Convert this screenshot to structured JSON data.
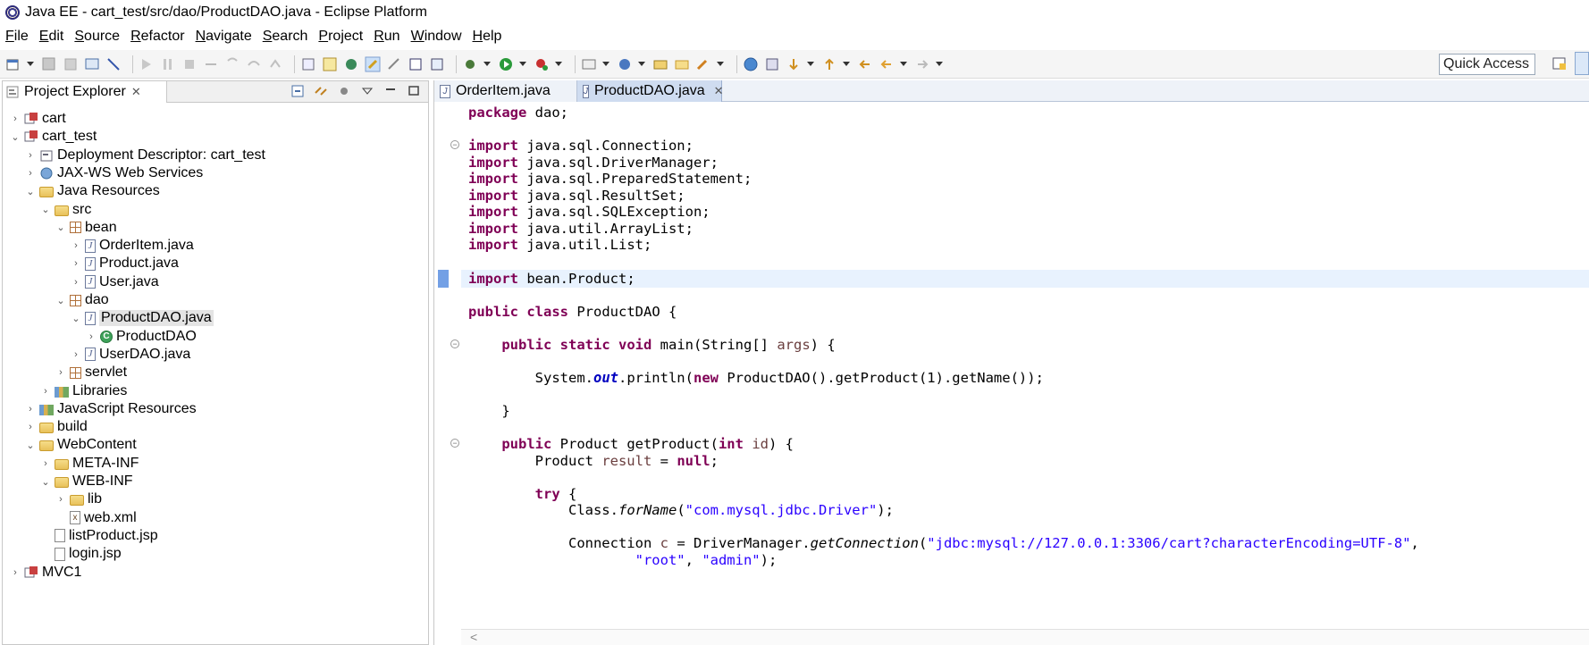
{
  "window": {
    "title": "Java EE - cart_test/src/dao/ProductDAO.java - Eclipse Platform"
  },
  "menu": [
    "File",
    "Edit",
    "Source",
    "Refactor",
    "Navigate",
    "Search",
    "Project",
    "Run",
    "Window",
    "Help"
  ],
  "toolbar": {
    "quick_access_label": "Quick Access"
  },
  "explorer": {
    "tab_label": "Project Explorer",
    "close": "✕",
    "items": [
      {
        "label": "cart",
        "depth": 0,
        "expanded": false,
        "icon": "project-icon"
      },
      {
        "label": "cart_test",
        "depth": 0,
        "expanded": true,
        "icon": "project-icon"
      },
      {
        "label": "Deployment Descriptor: cart_test",
        "depth": 1,
        "expanded": false,
        "icon": "deployment-descriptor-icon"
      },
      {
        "label": "JAX-WS Web Services",
        "depth": 1,
        "expanded": false,
        "icon": "web-services-icon"
      },
      {
        "label": "Java Resources",
        "depth": 1,
        "expanded": true,
        "icon": "java-resources-icon"
      },
      {
        "label": "src",
        "depth": 2,
        "expanded": true,
        "icon": "source-folder-icon"
      },
      {
        "label": "bean",
        "depth": 3,
        "expanded": true,
        "icon": "package-icon"
      },
      {
        "label": "OrderItem.java",
        "depth": 4,
        "expanded": false,
        "icon": "java-file-icon"
      },
      {
        "label": "Product.java",
        "depth": 4,
        "expanded": false,
        "icon": "java-file-icon"
      },
      {
        "label": "User.java",
        "depth": 4,
        "expanded": false,
        "icon": "java-file-icon"
      },
      {
        "label": "dao",
        "depth": 3,
        "expanded": true,
        "icon": "package-icon"
      },
      {
        "label": "ProductDAO.java",
        "depth": 4,
        "expanded": true,
        "icon": "java-file-icon",
        "selected": true
      },
      {
        "label": "ProductDAO",
        "depth": 5,
        "expanded": false,
        "icon": "class-icon"
      },
      {
        "label": "UserDAO.java",
        "depth": 4,
        "expanded": false,
        "icon": "java-file-icon"
      },
      {
        "label": "servlet",
        "depth": 3,
        "expanded": false,
        "icon": "package-icon"
      },
      {
        "label": "Libraries",
        "depth": 2,
        "expanded": false,
        "icon": "libraries-icon"
      },
      {
        "label": "JavaScript Resources",
        "depth": 1,
        "expanded": false,
        "icon": "javascript-resources-icon"
      },
      {
        "label": "build",
        "depth": 1,
        "expanded": false,
        "icon": "folder-icon"
      },
      {
        "label": "WebContent",
        "depth": 1,
        "expanded": true,
        "icon": "folder-icon"
      },
      {
        "label": "META-INF",
        "depth": 2,
        "expanded": false,
        "icon": "folder-icon"
      },
      {
        "label": "WEB-INF",
        "depth": 2,
        "expanded": true,
        "icon": "folder-icon"
      },
      {
        "label": "lib",
        "depth": 3,
        "expanded": false,
        "icon": "folder-icon"
      },
      {
        "label": "web.xml",
        "depth": 3,
        "leaf": true,
        "icon": "xml-file-icon"
      },
      {
        "label": "listProduct.jsp",
        "depth": 2,
        "leaf": true,
        "icon": "jsp-file-icon"
      },
      {
        "label": "login.jsp",
        "depth": 2,
        "leaf": true,
        "icon": "jsp-file-icon"
      },
      {
        "label": "MVC1",
        "depth": 0,
        "expanded": false,
        "icon": "project-icon"
      }
    ]
  },
  "editor": {
    "tabs": [
      {
        "label": "OrderItem.java",
        "active": false
      },
      {
        "label": "ProductDAO.java",
        "active": true
      }
    ],
    "close": "✕",
    "code_lines": [
      [
        [
          "kw",
          "package"
        ],
        [
          "t",
          " dao;"
        ]
      ],
      [],
      [
        [
          "kw",
          "import"
        ],
        [
          "t",
          " java.sql.Connection;"
        ]
      ],
      [
        [
          "kw",
          "import"
        ],
        [
          "t",
          " java.sql.DriverManager;"
        ]
      ],
      [
        [
          "kw",
          "import"
        ],
        [
          "t",
          " java.sql.PreparedStatement;"
        ]
      ],
      [
        [
          "kw",
          "import"
        ],
        [
          "t",
          " java.sql.ResultSet;"
        ]
      ],
      [
        [
          "kw",
          "import"
        ],
        [
          "t",
          " java.sql.SQLException;"
        ]
      ],
      [
        [
          "kw",
          "import"
        ],
        [
          "t",
          " java.util.ArrayList;"
        ]
      ],
      [
        [
          "kw",
          "import"
        ],
        [
          "t",
          " java.util.List;"
        ]
      ],
      [],
      [
        [
          "kw",
          "import"
        ],
        [
          "t",
          " bean.Product;"
        ]
      ],
      [],
      [
        [
          "kw",
          "public"
        ],
        [
          "t",
          " "
        ],
        [
          "kw",
          "class"
        ],
        [
          "t",
          " ProductDAO {"
        ]
      ],
      [],
      [
        [
          "t",
          "    "
        ],
        [
          "kw",
          "public"
        ],
        [
          "t",
          " "
        ],
        [
          "kw",
          "static"
        ],
        [
          "t",
          " "
        ],
        [
          "kw",
          "void"
        ],
        [
          "t",
          " main(String[] "
        ],
        [
          "var",
          "args"
        ],
        [
          "t",
          ") {"
        ]
      ],
      [],
      [
        [
          "t",
          "        System."
        ],
        [
          "fld",
          "out"
        ],
        [
          "t",
          ".println("
        ],
        [
          "kw",
          "new"
        ],
        [
          "t",
          " ProductDAO().getProduct(1).getName());"
        ]
      ],
      [],
      [
        [
          "t",
          "    }"
        ]
      ],
      [],
      [
        [
          "t",
          "    "
        ],
        [
          "kw",
          "public"
        ],
        [
          "t",
          " Product getProduct("
        ],
        [
          "kw",
          "int"
        ],
        [
          "t",
          " "
        ],
        [
          "var",
          "id"
        ],
        [
          "t",
          ") {"
        ]
      ],
      [
        [
          "t",
          "        Product "
        ],
        [
          "var",
          "result"
        ],
        [
          "t",
          " = "
        ],
        [
          "kw",
          "null"
        ],
        [
          "t",
          ";"
        ]
      ],
      [],
      [
        [
          "t",
          "        "
        ],
        [
          "kw",
          "try"
        ],
        [
          "t",
          " {"
        ]
      ],
      [
        [
          "t",
          "            Class."
        ],
        [
          "ital",
          "forName"
        ],
        [
          "t",
          "("
        ],
        [
          "str",
          "\"com.mysql.jdbc.Driver\""
        ],
        [
          "t",
          ");"
        ]
      ],
      [],
      [
        [
          "t",
          "            Connection "
        ],
        [
          "var",
          "c"
        ],
        [
          "t",
          " = DriverManager."
        ],
        [
          "ital",
          "getConnection"
        ],
        [
          "t",
          "("
        ],
        [
          "str",
          "\"jdbc:mysql://127.0.0.1:3306/cart?characterEncoding=UTF-8\""
        ],
        [
          "t",
          ","
        ]
      ],
      [
        [
          "t",
          "                    "
        ],
        [
          "str",
          "\"root\""
        ],
        [
          "t",
          ", "
        ],
        [
          "str",
          "\"admin\""
        ],
        [
          "t",
          ");"
        ]
      ]
    ],
    "highlighted_line": 10,
    "fold_lines": [
      2,
      14,
      20
    ],
    "scroll_hint": "<"
  }
}
